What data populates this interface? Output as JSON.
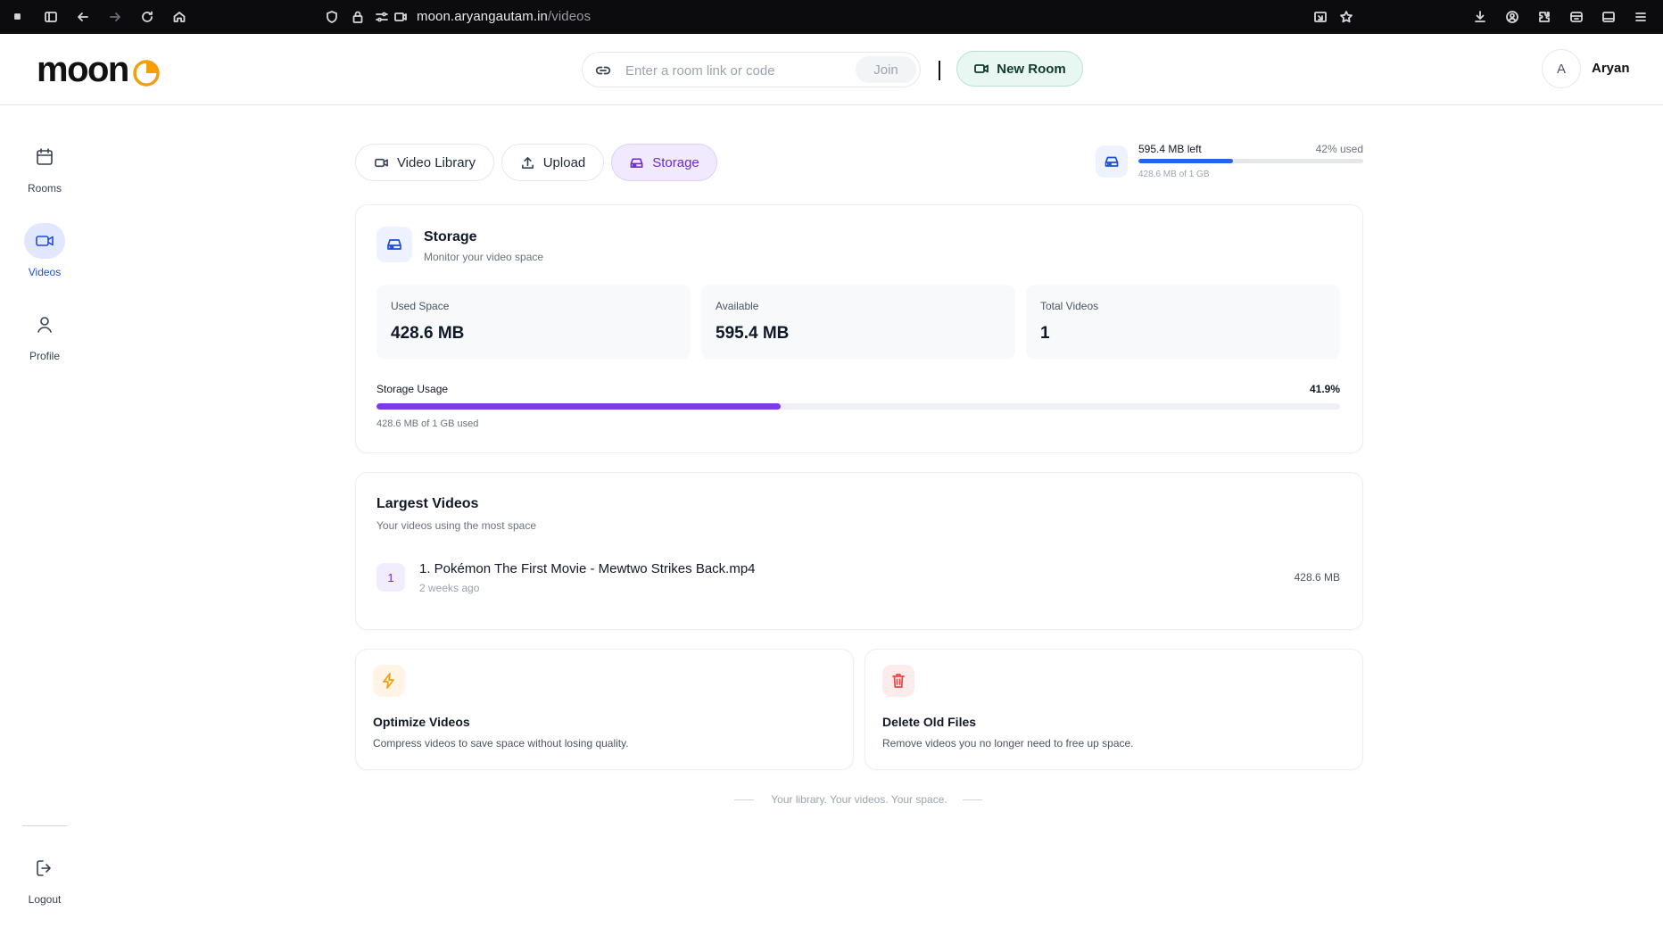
{
  "browser": {
    "url_host": "moon.aryangautam.in",
    "url_path": "/videos"
  },
  "header": {
    "logo_text": "moon",
    "join_placeholder": "Enter a room link or code",
    "join_label": "Join",
    "new_room_label": "New Room",
    "avatar_initial": "A",
    "user_name": "Aryan"
  },
  "sidebar": {
    "items": [
      {
        "label": "Rooms",
        "icon": "calendar-icon"
      },
      {
        "label": "Videos",
        "icon": "video-icon",
        "active": true
      },
      {
        "label": "Profile",
        "icon": "user-icon"
      }
    ],
    "logout_label": "Logout"
  },
  "tabs": [
    {
      "label": "Video Library",
      "icon": "video-icon"
    },
    {
      "label": "Upload",
      "icon": "upload-icon"
    },
    {
      "label": "Storage",
      "icon": "drive-icon",
      "active": true
    }
  ],
  "storage_mini": {
    "left_text": "595.4 MB left",
    "used_text": "42% used",
    "used_fraction": 0.42,
    "sub_text": "428.6 MB of 1 GB"
  },
  "storage_card": {
    "title": "Storage",
    "subtitle": "Monitor your video space",
    "stats": [
      {
        "label": "Used Space",
        "value": "428.6 MB"
      },
      {
        "label": "Available",
        "value": "595.4 MB"
      },
      {
        "label": "Total Videos",
        "value": "1"
      }
    ],
    "usage_label": "Storage Usage",
    "usage_percent_text": "41.9%",
    "usage_fraction": 0.419,
    "usage_sub": "428.6 MB of 1 GB used"
  },
  "largest_videos": {
    "title": "Largest Videos",
    "subtitle": "Your videos using the most space",
    "items": [
      {
        "rank": "1",
        "name": "1. Pokémon The First Movie - Mewtwo Strikes Back.mp4",
        "time": "2 weeks ago",
        "size": "428.6 MB"
      }
    ]
  },
  "tips": [
    {
      "title": "Optimize Videos",
      "text": "Compress videos to save space without losing quality.",
      "icon": "bolt-icon",
      "accent": "#f59e0b"
    },
    {
      "title": "Delete Old Files",
      "text": "Remove videos you no longer need to free up space.",
      "icon": "trash-icon",
      "accent": "#ef4444"
    }
  ],
  "footer_text": "Your library. Your videos. Your space.",
  "colors": {
    "accent_purple": "#7c3aed",
    "accent_blue": "#2563eb",
    "new_room_bg": "#e8f7f2"
  }
}
